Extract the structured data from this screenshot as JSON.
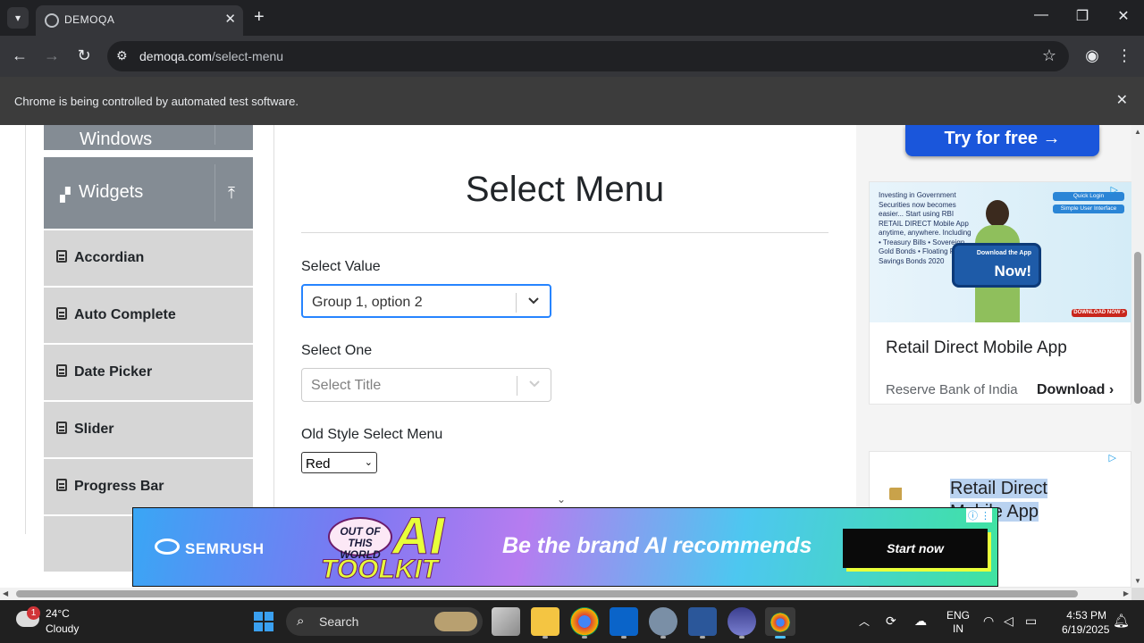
{
  "browser": {
    "tab_title": "DEMOQA",
    "url_host": "demoqa.com",
    "url_path": "/select-menu",
    "infobar_text": "Chrome is being controlled by automated test software."
  },
  "sidebar": {
    "group_windows": "Windows",
    "group_widgets": "Widgets",
    "items": [
      {
        "label": "Accordian"
      },
      {
        "label": "Auto Complete"
      },
      {
        "label": "Date Picker"
      },
      {
        "label": "Slider"
      },
      {
        "label": "Progress Bar"
      }
    ]
  },
  "main": {
    "title": "Select Menu",
    "select_value": {
      "label": "Select Value",
      "value": "Group 1, option 2"
    },
    "select_one": {
      "label": "Select One",
      "placeholder": "Select Title"
    },
    "old_style": {
      "label": "Old Style Select Menu",
      "value": "Red"
    }
  },
  "ads": {
    "try_button": "Try for free →",
    "card1": {
      "image_text": "Investing in Government Securities now becomes easier... Start using RBI RETAIL DIRECT Mobile App anytime, anywhere. Including • Treasury Bills • Sovereign Gold Bonds • Floating Rate Savings Bonds 2020",
      "phone_top": "Download the App",
      "phone_big": "Now!",
      "badge1": "Quick Login",
      "badge2": "Simple User Interface",
      "download_badge": "DOWNLOAD NOW >",
      "headline": "Retail Direct Mobile App",
      "advertiser": "Reserve Bank of India",
      "cta": "Download"
    },
    "card2": {
      "headline_line1": "Retail Direct",
      "headline_line2": "Mobile App"
    },
    "banner": {
      "brand": "SEMRUSH",
      "badge": "OUT OF THIS WORLD",
      "big": "AI",
      "toolkit": "TOOLKIT",
      "slogan": "Be the brand AI recommends",
      "cta": "Start now"
    }
  },
  "taskbar": {
    "weather_badge": "1",
    "temperature": "24°C",
    "condition": "Cloudy",
    "search_label": "Search",
    "lang_line1": "ENG",
    "lang_line2": "IN",
    "time": "4:53 PM",
    "date": "6/19/2025"
  },
  "colors": {
    "sidebar_header": "#848c94",
    "sidebar_item": "#d6d6d6",
    "focus_border": "#2684ff",
    "chrome_dark": "#202124",
    "taskbar": "#202020"
  }
}
